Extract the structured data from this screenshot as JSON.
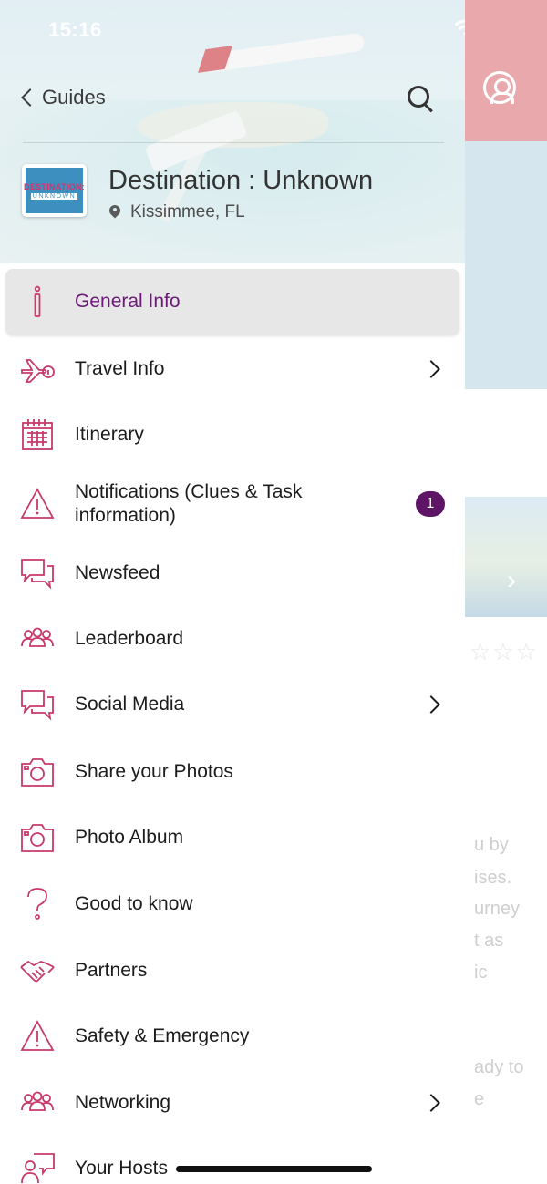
{
  "status_bar": {
    "time": "15:16"
  },
  "header": {
    "back_label": "Guides",
    "title": "Destination : Unknown",
    "location": "Kissimmee, FL",
    "logo": {
      "line1": "DESTINATION:",
      "line2": "UNKNOWN"
    }
  },
  "menu": {
    "items": [
      {
        "label": "General Info",
        "icon": "info-icon",
        "active": true
      },
      {
        "label": "Travel Info",
        "icon": "plane-info-icon",
        "chevron": true
      },
      {
        "label": "Itinerary",
        "icon": "calendar-icon"
      },
      {
        "label": "Notifications (Clues & Task information)",
        "icon": "warning-icon",
        "badge": "1"
      },
      {
        "label": "Newsfeed",
        "icon": "chat-icon"
      },
      {
        "label": "Leaderboard",
        "icon": "people-icon"
      },
      {
        "label": "Social Media",
        "icon": "chat-icon",
        "chevron": true
      },
      {
        "label": "Share your Photos",
        "icon": "camera-icon"
      },
      {
        "label": "Photo Album",
        "icon": "camera-icon"
      },
      {
        "label": "Good to know",
        "icon": "question-icon"
      },
      {
        "label": "Partners",
        "icon": "handshake-icon"
      },
      {
        "label": "Safety & Emergency",
        "icon": "warning-icon"
      },
      {
        "label": "Networking",
        "icon": "people-icon",
        "chevron": true
      },
      {
        "label": "Your Hosts",
        "icon": "host-icon"
      }
    ]
  },
  "background_page": {
    "text_fragments": [
      "u by",
      "ises.",
      "urney",
      "t as",
      "ic",
      "ady to",
      "e"
    ]
  },
  "colors": {
    "icon_accent": "#c73a6a",
    "active_text": "#6b1a78",
    "badge_bg": "#5e1565",
    "header_bg_right": "#e9a9ac"
  }
}
